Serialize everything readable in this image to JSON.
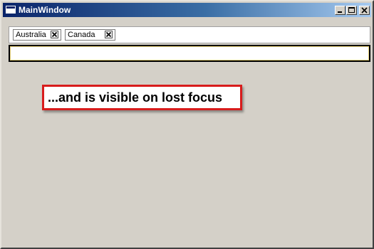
{
  "window": {
    "title": "MainWindow",
    "icon": "window-icon",
    "controls": [
      "minimize-icon",
      "maximize-icon",
      "close-icon"
    ]
  },
  "tag_box": {
    "tags": [
      {
        "label": "Australia",
        "remove_icon": "close-icon"
      },
      {
        "label": "Canada",
        "remove_icon": "close-icon"
      }
    ]
  },
  "text_input": {
    "value": ""
  },
  "callout": {
    "text": "...and is visible on lost focus",
    "border_color": "#d81c1c"
  },
  "colors": {
    "title_gradient_start": "#0a246a",
    "title_gradient_end": "#a6caf0",
    "window_background": "#d4d0c8"
  }
}
